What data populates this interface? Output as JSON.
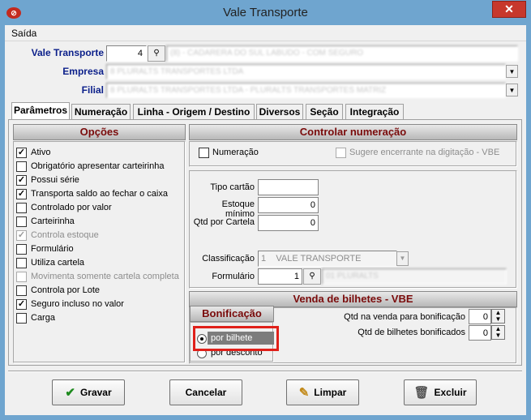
{
  "window": {
    "title": "Vale Transporte",
    "app_icon": "app-logo-icon",
    "close_glyph": "✕"
  },
  "menu": {
    "items": [
      "Saída"
    ]
  },
  "header": {
    "vale_label": "Vale Transporte",
    "vale_code": "4",
    "vale_name": "(8) - CADARERA DO SUL LABUDO - COM SEGURO",
    "empresa_label": "Empresa",
    "empresa_value": "8 PLURALTS TRANSPORTES LTDA",
    "filial_label": "Filial",
    "filial_value": "8 PLURALTS TRANSPORTES LTDA - PLURALTS TRANSPORTES MATRIZ"
  },
  "tabs": [
    "Parâmetros",
    "Numeração",
    "Linha - Origem / Destino",
    "Diversos",
    "Seção",
    "Integração"
  ],
  "active_tab": "Parâmetros",
  "opcoes": {
    "title": "Opções",
    "items": [
      {
        "label": "Ativo",
        "checked": true,
        "disabled": false
      },
      {
        "label": "Obrigatório apresentar carteirinha",
        "checked": false,
        "disabled": false
      },
      {
        "label": "Possui série",
        "checked": true,
        "disabled": false
      },
      {
        "label": "Transporta saldo ao fechar o caixa",
        "checked": true,
        "disabled": false
      },
      {
        "label": "Controlado por valor",
        "checked": false,
        "disabled": false
      },
      {
        "label": "Carteirinha",
        "checked": false,
        "disabled": false
      },
      {
        "label": "Controla estoque",
        "checked": true,
        "disabled": true
      },
      {
        "label": "Formulário",
        "checked": false,
        "disabled": false
      },
      {
        "label": "Utiliza cartela",
        "checked": false,
        "disabled": false
      },
      {
        "label": "Movimenta somente cartela completa",
        "checked": false,
        "disabled": true
      },
      {
        "label": "Controla por Lote",
        "checked": false,
        "disabled": false
      },
      {
        "label": "Seguro incluso no valor",
        "checked": true,
        "disabled": false
      },
      {
        "label": "Carga",
        "checked": false,
        "disabled": false
      }
    ]
  },
  "controlar": {
    "title": "Controlar numeração",
    "numeracao_label": "Numeração",
    "sugere_label": "Sugere encerrante na digitação - VBE"
  },
  "fields": {
    "tipo_cartao_label": "Tipo cartão",
    "tipo_cartao_value": "",
    "estoque_label": "Estoque mínimo",
    "estoque_value": "0",
    "qtd_cartela_label": "Qtd por Cartela",
    "qtd_cartela_value": "0",
    "classificacao_label": "Classificação",
    "classificacao_value": "1    VALE TRANSPORTE",
    "formulario_label": "Formulário",
    "formulario_code": "1",
    "formulario_name": "01 PLURALTS"
  },
  "vbe": {
    "title": "Venda de bilhetes - VBE",
    "bonificacao_title": "Bonificação",
    "radio_bilhete": "por bilhete",
    "radio_desconto": "por desconto",
    "qtd_venda_label": "Qtd na venda para bonificação",
    "qtd_venda_value": "0",
    "qtd_bilhetes_label": "Qtd de bilhetes bonificados",
    "qtd_bilhetes_value": "0"
  },
  "buttons": {
    "gravar": "Gravar",
    "cancelar": "Cancelar",
    "limpar": "Limpar",
    "excluir": "Excluir"
  },
  "colors": {
    "highlight": "#e0201a",
    "section_title": "#7a0b0b",
    "label_blue": "#0b1f8a",
    "frame": "#6fa5cf"
  }
}
